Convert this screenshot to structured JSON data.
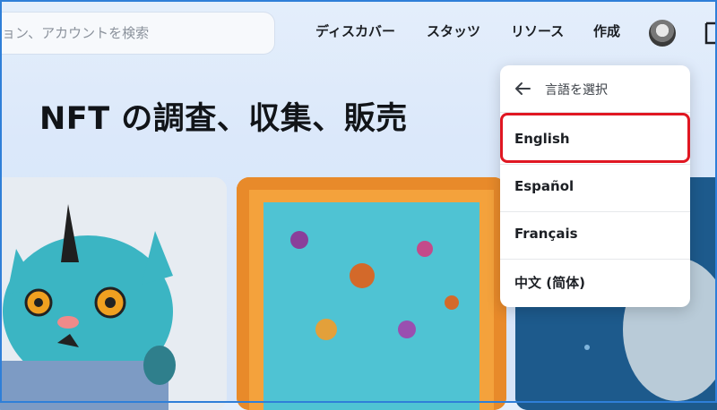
{
  "header": {
    "search_placeholder": "ョン、アカウントを検索",
    "nav": [
      "ディスカバー",
      "スタッツ",
      "リソース",
      "作成"
    ]
  },
  "hero": {
    "title": "NFT の調査、収集、販売"
  },
  "language_menu": {
    "title": "言語を選択",
    "items": [
      "English",
      "Español",
      "Français",
      "中文 (简体)"
    ],
    "highlighted_index": 0
  },
  "colors": {
    "highlight": "#e01722",
    "frame": "#2f7fd8"
  }
}
